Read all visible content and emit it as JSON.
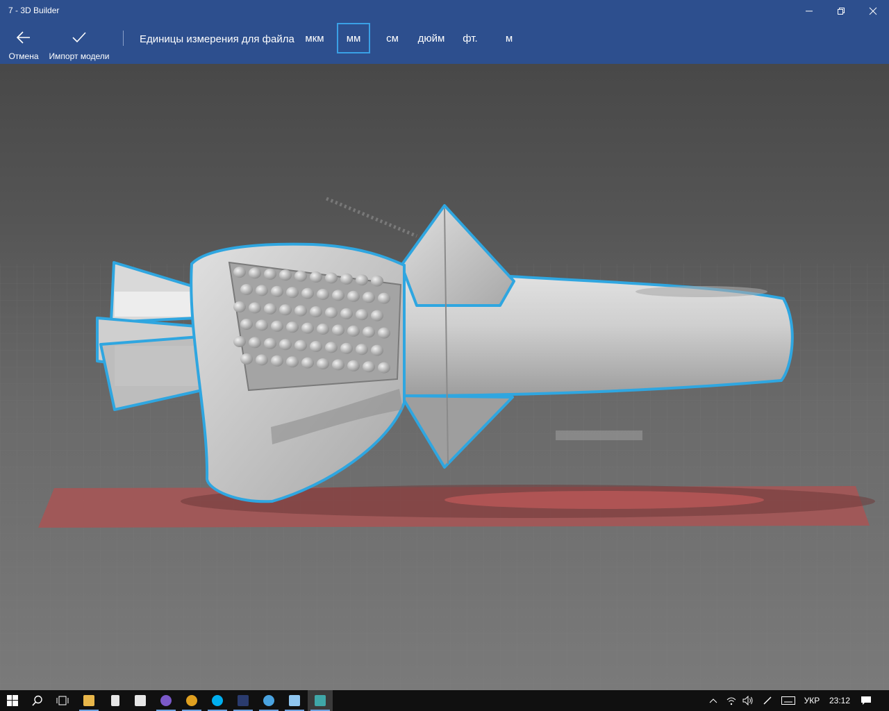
{
  "window": {
    "title": "7 - 3D Builder",
    "minimize_glyph": "—",
    "maximize_glyph": "❐",
    "close_glyph": "✕"
  },
  "commandbar": {
    "cancel_label": "Отмена",
    "cancel_icon": "back-arrow-icon",
    "import_label": "Импорт модели",
    "import_icon": "checkmark-icon",
    "units_label": "Единицы измерения для файла",
    "units": [
      {
        "label": "мкм",
        "selected": false
      },
      {
        "label": "мм",
        "selected": true
      },
      {
        "label": "см",
        "selected": false
      },
      {
        "label": "дюйм",
        "selected": false
      },
      {
        "label": "фт.",
        "selected": false
      },
      {
        "label": "м",
        "selected": false
      }
    ]
  },
  "viewport": {
    "model": "ring-model",
    "selection_color": "#2fa6e0",
    "platform_color": "#b05050"
  },
  "taskbar": {
    "apps": [
      {
        "name": "start-button",
        "icon": "windows-icon"
      },
      {
        "name": "search-button",
        "icon": "search-icon"
      },
      {
        "name": "task-view-button",
        "icon": "task-view-icon"
      },
      {
        "name": "file-explorer-button",
        "icon": "folder-icon",
        "color": "#e8b64a"
      },
      {
        "name": "calculator-button",
        "icon": "calculator-icon",
        "color": "#e6e6e6"
      },
      {
        "name": "store-button",
        "icon": "store-icon",
        "color": "#e6e6e6"
      },
      {
        "name": "viber-button",
        "icon": "viber-icon",
        "color": "#7b59c9"
      },
      {
        "name": "chrome-button",
        "icon": "chrome-icon",
        "color": "#e0a020"
      },
      {
        "name": "skype-button",
        "icon": "skype-icon",
        "color": "#00aff0"
      },
      {
        "name": "photoshop-button",
        "icon": "photoshop-icon",
        "color": "#2a3b6e"
      },
      {
        "name": "browser-button",
        "icon": "browser-icon",
        "color": "#4aa3e0"
      },
      {
        "name": "notepad-button",
        "icon": "notepad-icon",
        "color": "#8fc6f0"
      },
      {
        "name": "3d-builder-button",
        "icon": "3d-builder-icon",
        "color": "#3fa7a8"
      }
    ],
    "tray": {
      "language": "УКР",
      "time": "23:12"
    }
  }
}
